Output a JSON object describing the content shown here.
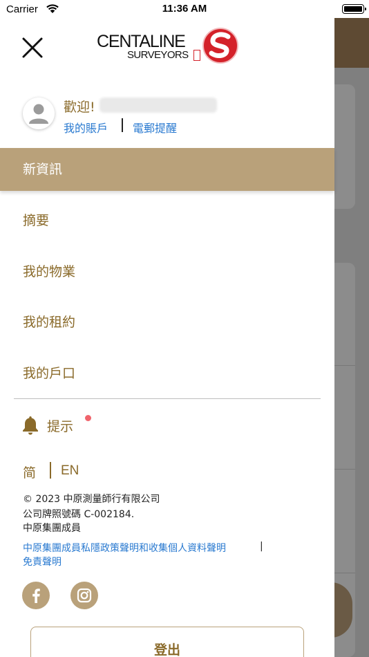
{
  "status_bar": {
    "carrier": "Carrier",
    "time": "11:36 AM"
  },
  "header": {
    "logo_line1": "CENTALINE",
    "logo_line2": "SURVEYORS"
  },
  "user": {
    "welcome": "歡迎!",
    "my_account": "我的賬戶",
    "email_alert": "電郵提醒"
  },
  "menu": {
    "items": [
      {
        "label": "新資訊",
        "active": true
      },
      {
        "label": "摘要",
        "active": false
      },
      {
        "label": "我的物業",
        "active": false
      },
      {
        "label": "我的租約",
        "active": false
      },
      {
        "label": "我的戶口",
        "active": false
      }
    ]
  },
  "notifications": {
    "label": "提示"
  },
  "language": {
    "simplified": "简",
    "english": "EN"
  },
  "footer": {
    "copyright": "© 2023 中原測量師行有限公司",
    "license": "公司牌照號碼 C-002184.",
    "member": "中原集團成員",
    "privacy_link": "中原集團成員私隱政策聲明和收集個人資料聲明",
    "separator": "|",
    "disclaimer_link": "免責聲明"
  },
  "logout": {
    "label": "登出"
  },
  "colors": {
    "brand_gold": "#b9a17a",
    "text_gold": "#8a6a2a",
    "link_blue": "#2a7ad0",
    "notification_dot": "#f0646c",
    "logo_red": "#d4222a"
  }
}
